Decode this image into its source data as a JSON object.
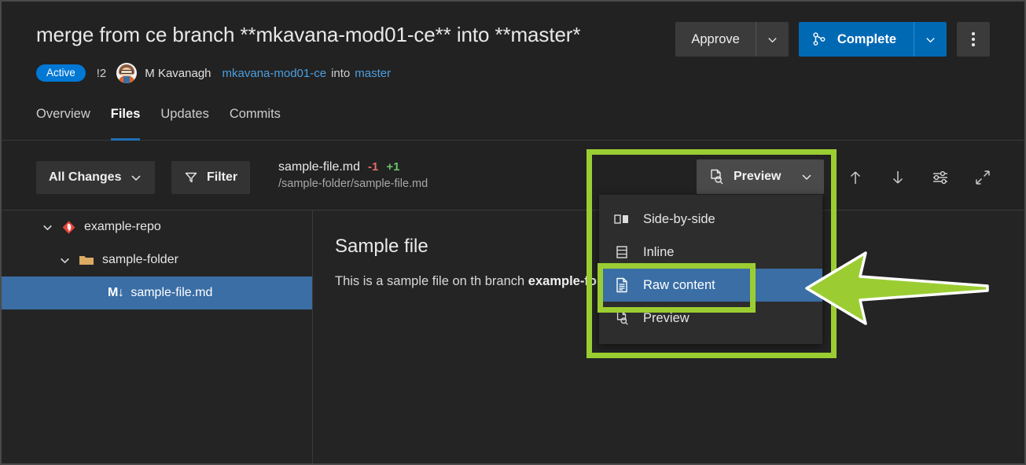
{
  "header": {
    "title": "merge from ce branch **mkavana-mod01-ce** into **master*",
    "status_badge": "Active",
    "pr_id": "!2",
    "author": "M Kavanagh",
    "source_branch": "mkavana-mod01-ce",
    "into_label": "into",
    "target_branch": "master",
    "avatar_name": "avatar"
  },
  "actions": {
    "approve_label": "Approve",
    "approve_caret": "∨",
    "complete_label": "Complete",
    "complete_caret": "∨",
    "more_label": "",
    "primary_color": "#0069b4",
    "secondary_color": "#3b3b3b"
  },
  "tabs": [
    {
      "label": "Overview",
      "active": false
    },
    {
      "label": "Files",
      "active": true
    },
    {
      "label": "Updates",
      "active": false
    },
    {
      "label": "Commits",
      "active": false
    }
  ],
  "toolbar": {
    "all_changes_label": "All Changes",
    "all_changes_caret": "∨",
    "filter_label": "Filter",
    "preview_label": "Preview",
    "preview_caret": "∨",
    "icons": [
      "arrow-up-icon",
      "arrow-down-icon",
      "settings-sliders-icon",
      "expand-icon"
    ]
  },
  "file": {
    "name": "sample-file.md",
    "deletions": "-1",
    "additions": "+1",
    "path": "/sample-folder/sample-file.md"
  },
  "tree": [
    {
      "label": "example-repo",
      "level": 0,
      "icon": "azure-repo-icon",
      "expanded": true,
      "selected": false
    },
    {
      "label": "sample-folder",
      "level": 1,
      "icon": "folder-icon",
      "expanded": true,
      "selected": false
    },
    {
      "label": "sample-file.md",
      "level": 2,
      "icon": "markdown-icon",
      "badge": "M↓",
      "selected": true
    }
  ],
  "content": {
    "doc_title": "Sample file",
    "doc_text_prefix": "This is a sample file on th branch ",
    "doc_text_bold": "exa",
    "doc_text_suffix": "mple-folder"
  },
  "menu": {
    "items": [
      {
        "label": "Side-by-side",
        "icon": "side-by-side-icon",
        "selected": false
      },
      {
        "label": "Inline",
        "icon": "inline-icon",
        "selected": false
      },
      {
        "label": "Raw content",
        "icon": "raw-content-icon",
        "selected": true
      },
      {
        "label": "Preview",
        "icon": "preview-icon",
        "selected": false
      }
    ]
  },
  "annotations": {
    "highlight_color": "#9bcd32",
    "arrow_color": "#9bcd32",
    "arrow_direction": "left"
  }
}
